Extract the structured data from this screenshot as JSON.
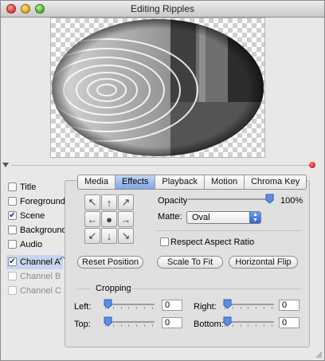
{
  "window": {
    "title": "Editing Ripples"
  },
  "channels": [
    {
      "label": "Title",
      "checked": false,
      "enabled": true
    },
    {
      "label": "Foreground",
      "checked": false,
      "enabled": true
    },
    {
      "label": "Scene",
      "checked": true,
      "enabled": true
    },
    {
      "label": "Background",
      "checked": false,
      "enabled": true
    },
    {
      "label": "Audio",
      "checked": false,
      "enabled": true
    },
    {
      "label": "Channel A",
      "checked": true,
      "enabled": true,
      "selected": true
    },
    {
      "label": "Channel B",
      "checked": false,
      "enabled": false
    },
    {
      "label": "Channel C",
      "checked": false,
      "enabled": false
    }
  ],
  "tabs": [
    {
      "label": "Media",
      "active": false
    },
    {
      "label": "Effects",
      "active": true
    },
    {
      "label": "Playback",
      "active": false
    },
    {
      "label": "Motion",
      "active": false
    },
    {
      "label": "Chroma Key",
      "active": false
    }
  ],
  "effects": {
    "position_arrows": [
      "arrow-up-left-icon",
      "arrow-up-icon",
      "arrow-up-right-icon",
      "arrow-left-icon",
      "center-dot-icon",
      "arrow-right-icon",
      "arrow-down-left-icon",
      "arrow-down-icon",
      "arrow-down-right-icon"
    ],
    "opacity_label": "Opacity",
    "opacity_value": "100%",
    "opacity_fraction": 1.0,
    "matte_label": "Matte:",
    "matte_value": "Oval",
    "respect_aspect_label": "Respect Aspect Ratio",
    "respect_aspect_checked": false,
    "reset_position_label": "Reset Position",
    "scale_to_fit_label": "Scale To Fit",
    "horizontal_flip_label": "Horizontal Flip",
    "cropping_label": "Cropping",
    "crop": {
      "left_label": "Left:",
      "left_value": "0",
      "right_label": "Right:",
      "right_value": "0",
      "top_label": "Top:",
      "top_value": "0",
      "bottom_label": "Bottom:",
      "bottom_value": "0"
    }
  },
  "colors": {
    "accent": "#7fa7e5",
    "selection": "#c7d5ef",
    "record_dot": "#c40000"
  }
}
